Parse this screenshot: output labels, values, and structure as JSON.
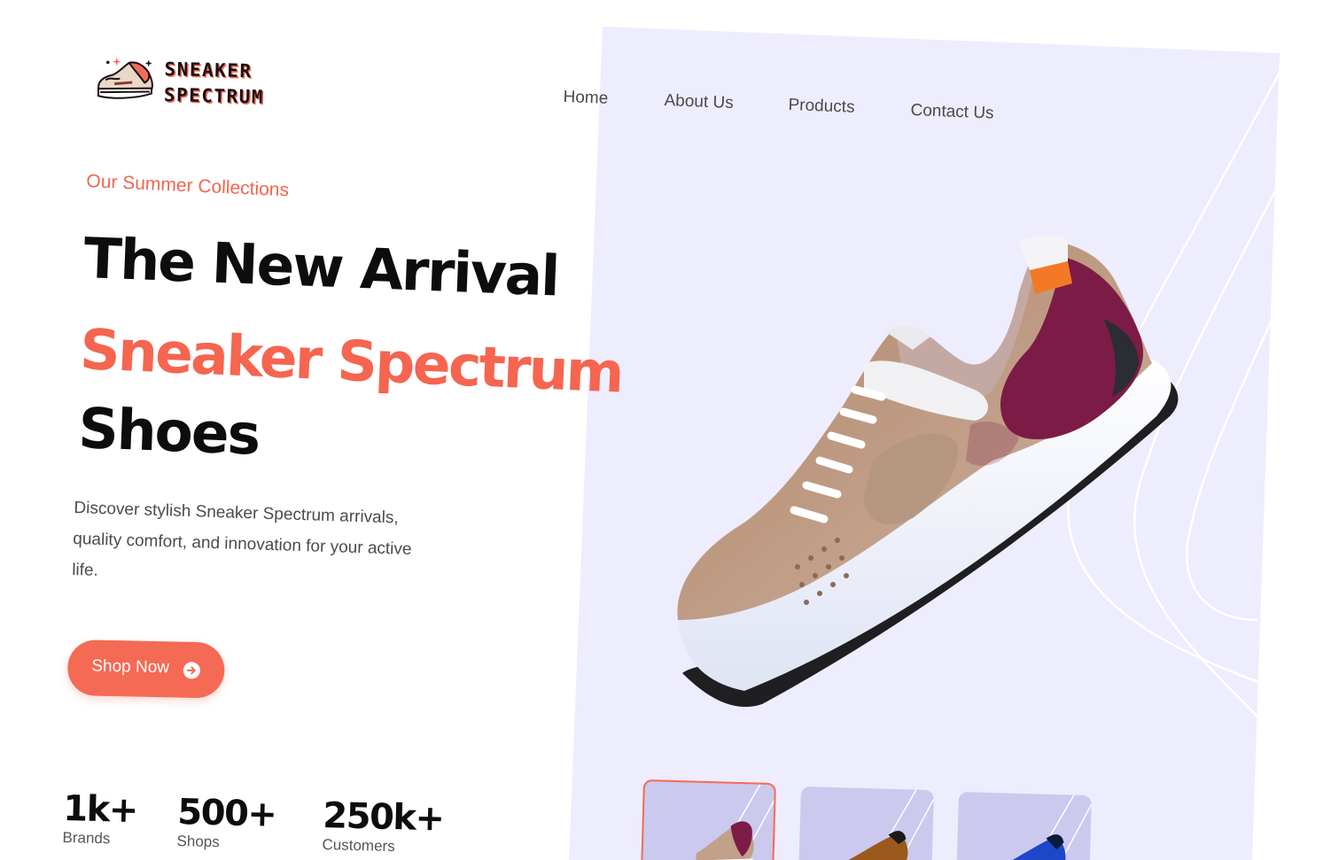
{
  "brand": {
    "line1": "SNEAKER",
    "line2": "SPECTRUM",
    "logo_icon": "sneaker-logo-icon"
  },
  "nav": {
    "items": [
      {
        "label": "Home"
      },
      {
        "label": "About Us"
      },
      {
        "label": "Products"
      },
      {
        "label": "Contact Us"
      }
    ]
  },
  "hero": {
    "eyebrow": "Our Summer Collections",
    "title_line1": "The New Arrival",
    "title_line2": "Sneaker Spectrum",
    "title_line3": "Shoes",
    "description": "Discover stylish Sneaker Spectrum arrivals, quality comfort, and innovation for your active life.",
    "cta_label": "Shop Now",
    "cta_icon": "arrow-right-circle-icon"
  },
  "stats": [
    {
      "value": "1k+",
      "label": "Brands"
    },
    {
      "value": "500+",
      "label": "Shops"
    },
    {
      "value": "250k+",
      "label": "Customers"
    }
  ],
  "thumbnails": [
    {
      "name": "sneaker-thumbnail-purple",
      "active": true
    },
    {
      "name": "sneaker-thumbnail-brown",
      "active": false
    },
    {
      "name": "sneaker-thumbnail-blue",
      "active": false
    }
  ],
  "colors": {
    "accent": "#f56a55",
    "panel_background": "#eeedfd",
    "heading": "#0d0d0d",
    "body_text": "#4b4b4b"
  }
}
